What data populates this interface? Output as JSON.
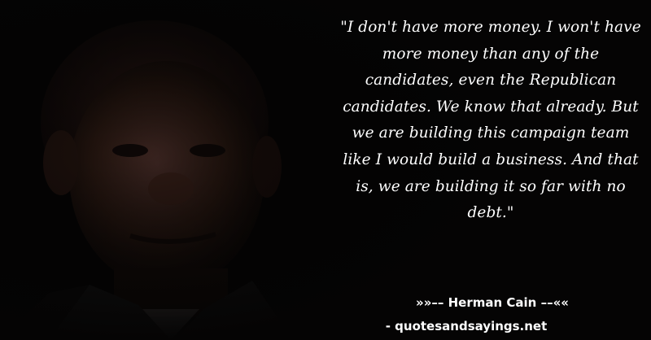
{
  "quote": {
    "text": "\"I don't have more money. I won't have more money than any of the candidates, even the Republican candidates. We know that already. But we are building this campaign team like I would build a business. And that is, we are building it so far with no debt.\""
  },
  "attribution": {
    "author_line": "»»–– Herman Cain ––««",
    "website": "- quotesandsayings.net"
  },
  "colors": {
    "background": "#050404",
    "text": "#ffffff"
  }
}
